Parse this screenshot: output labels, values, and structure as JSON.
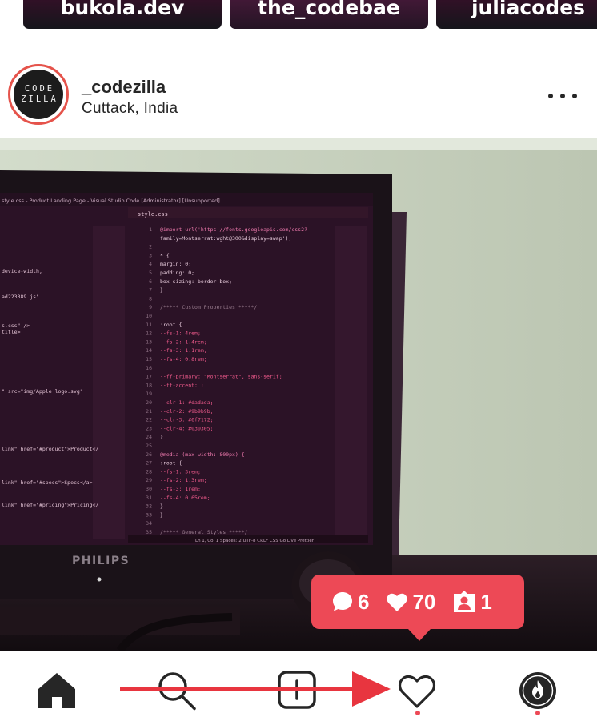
{
  "stories": [
    {
      "username": "bukola.dev"
    },
    {
      "username": "the_codebae"
    },
    {
      "username": "juliacodes"
    }
  ],
  "post": {
    "avatar_text": [
      "CODE",
      "ZILLA"
    ],
    "username": "_codezilla",
    "location": "Cuttack, India",
    "more_icon": "more-horizontal-icon",
    "photo": {
      "monitor_brand": "PHILIPS",
      "editor_title": "style.css - Product Landing Page - Visual Studio Code [Administrator] [Unsupported]",
      "tab_label": "style.css",
      "code_lines": [
        {
          "n": "1",
          "t": "@import url('https://fonts.googleapis.com/css2?"
        },
        {
          "n": "",
          "t": "family=Montserrat:wght@300&display=swap');"
        },
        {
          "n": "2",
          "t": ""
        },
        {
          "n": "3",
          "t": "* {"
        },
        {
          "n": "4",
          "t": "  margin: 0;"
        },
        {
          "n": "5",
          "t": "  padding: 0;"
        },
        {
          "n": "6",
          "t": "  box-sizing: border-box;"
        },
        {
          "n": "7",
          "t": "}"
        },
        {
          "n": "8",
          "t": ""
        },
        {
          "n": "9",
          "t": "/***** Custom Properties *****/"
        },
        {
          "n": "10",
          "t": ""
        },
        {
          "n": "11",
          "t": ":root {"
        },
        {
          "n": "12",
          "t": "  --fs-1: 4rem;"
        },
        {
          "n": "13",
          "t": "  --fs-2: 1.4rem;"
        },
        {
          "n": "14",
          "t": "  --fs-3: 1.1rem;"
        },
        {
          "n": "15",
          "t": "  --fs-4: 0.8rem;"
        },
        {
          "n": "16",
          "t": ""
        },
        {
          "n": "17",
          "t": "  --ff-primary: \"Montserrat\", sans-serif;"
        },
        {
          "n": "18",
          "t": "  --ff-accent: ;"
        },
        {
          "n": "19",
          "t": ""
        },
        {
          "n": "20",
          "t": "  --clr-1: #dadada;"
        },
        {
          "n": "21",
          "t": "  --clr-2: #9b9b9b;"
        },
        {
          "n": "22",
          "t": "  --clr-3: #6f7172;"
        },
        {
          "n": "23",
          "t": "  --clr-4: #030305;"
        },
        {
          "n": "24",
          "t": "}"
        },
        {
          "n": "25",
          "t": ""
        },
        {
          "n": "26",
          "t": "@media (max-width: 800px) {"
        },
        {
          "n": "27",
          "t": "  :root {"
        },
        {
          "n": "28",
          "t": "    --fs-1: 3rem;"
        },
        {
          "n": "29",
          "t": "    --fs-2: 1.3rem;"
        },
        {
          "n": "30",
          "t": "    --fs-3: 1rem;"
        },
        {
          "n": "31",
          "t": "    --fs-4: 0.65rem;"
        },
        {
          "n": "32",
          "t": "  }"
        },
        {
          "n": "33",
          "t": "}"
        },
        {
          "n": "34",
          "t": ""
        },
        {
          "n": "35",
          "t": "/***** General Styles *****/"
        }
      ],
      "left_pane_lines": [
        "device-width,",
        "ad223389.js\"",
        "s.css\" />",
        "title>",
        "\" src=\"img/Apple logo.svg\"",
        "link\" href=\"#product\">Product</",
        "link\" href=\"#specs\">Specs</a>",
        "link\" href=\"#pricing\">Pricing</"
      ],
      "status_bar": "Ln 1, Col 1   Spaces: 2   UTF-8   CRLF   CSS   Go Live   Prettier"
    }
  },
  "activity_tooltip": {
    "comments": {
      "icon": "comment-bubble-icon",
      "count": "6"
    },
    "likes": {
      "icon": "heart-icon",
      "count": "70"
    },
    "follows": {
      "icon": "person-badge-icon",
      "count": "1"
    }
  },
  "nav": [
    {
      "icon": "home-icon"
    },
    {
      "icon": "search-icon"
    },
    {
      "icon": "new-post-icon"
    },
    {
      "icon": "heart-outline-icon"
    },
    {
      "icon": "profile-flame-icon"
    }
  ],
  "colors": {
    "accent": "#ed4956",
    "annotation_arrow": "#e8353f",
    "story_bg": "#2a1024",
    "screen_bg": "#2b1226"
  }
}
